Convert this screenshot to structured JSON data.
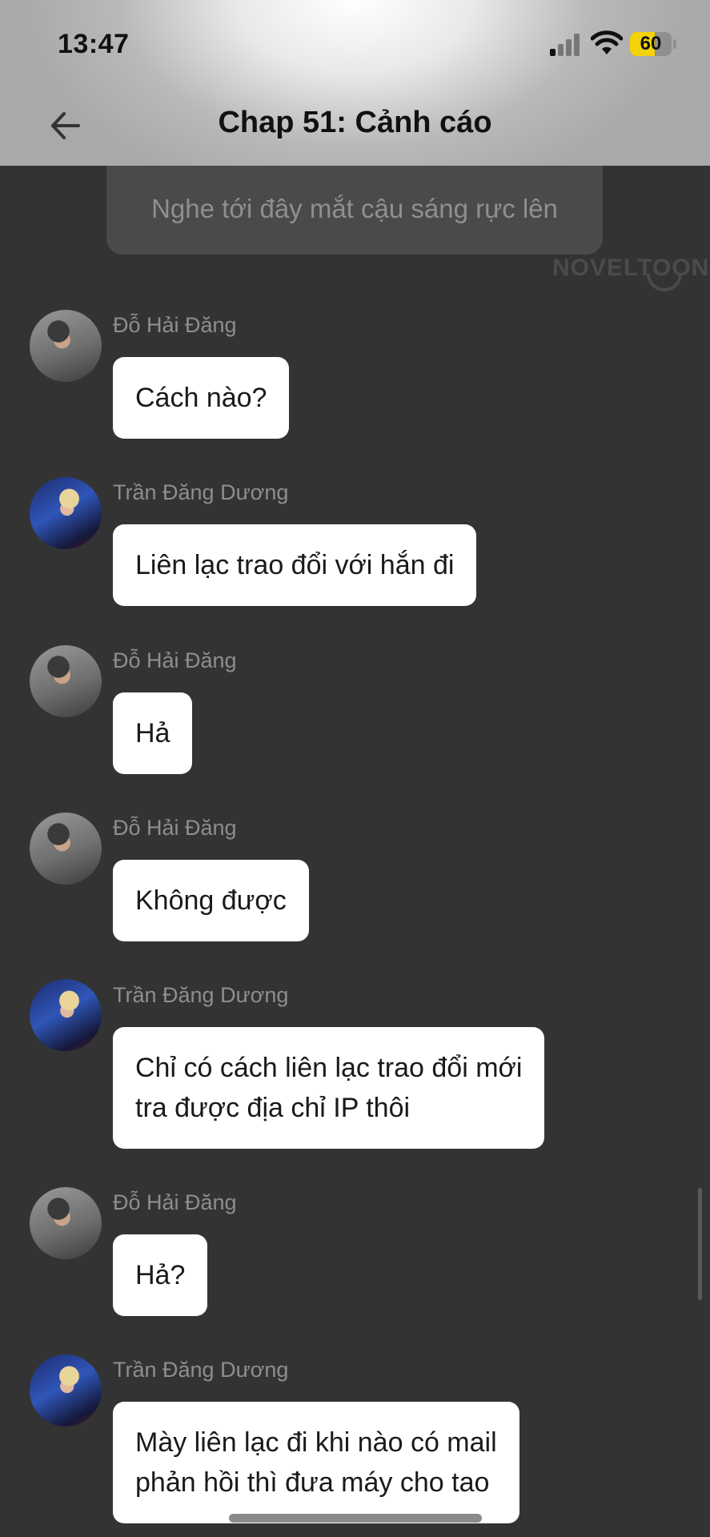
{
  "status_bar": {
    "time": "13:47",
    "battery": "60",
    "battery_level": 0.6
  },
  "header": {
    "title": "Chap 51: Cảnh cáo"
  },
  "narration": "Nghe tới đây mắt cậu sáng rực lên",
  "watermark": "NOVELTOON",
  "messages": [
    {
      "sender": "Đỗ Hải Đăng",
      "text": "Cách nào?"
    },
    {
      "sender": "Trần Đăng Dương",
      "text": "Liên lạc trao đổi với hắn đi"
    },
    {
      "sender": "Đỗ Hải Đăng",
      "text": "Hả"
    },
    {
      "sender": "Đỗ Hải Đăng",
      "text": "Không được"
    },
    {
      "sender": "Trần Đăng Dương",
      "text": "Chỉ có cách liên lạc trao đổi mới\ntra được địa chỉ IP thôi"
    },
    {
      "sender": "Đỗ Hải Đăng",
      "text": "Hả?"
    },
    {
      "sender": "Trần Đăng Dương",
      "text": "Mày liên lạc đi khi nào có mail\nphản hồi thì đưa máy cho tao"
    }
  ]
}
